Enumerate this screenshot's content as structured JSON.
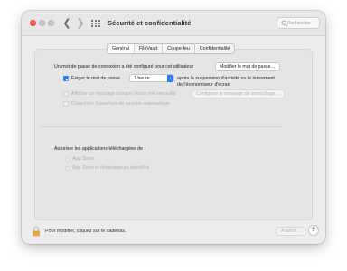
{
  "window": {
    "title": "Sécurité et confidentialité",
    "search_placeholder": "Rechercher"
  },
  "tabs": [
    {
      "label": "Général",
      "active": true
    },
    {
      "label": "FileVault",
      "active": false
    },
    {
      "label": "Coupe-feu",
      "active": false
    },
    {
      "label": "Confidentialité",
      "active": false
    }
  ],
  "general": {
    "password_text": "Un mot de passe de connexion a été configuré pour cet utilisateur",
    "change_password_button": "Modifier le mot de passe…",
    "require_password_label": "Exiger le mot de passe",
    "require_password_checked": true,
    "delay_select_value": "1 heure",
    "after_text_line1": "après la suspension d'activité ou le lancement",
    "after_text_line2": "de l'économiseur d'écran",
    "show_message_label": "Afficher un message lorsque l'écran est verrouillé",
    "configure_message_button": "Configurer le message de verrouillage…",
    "disable_auto_login_label": "Désactiver l'ouverture de session automatique"
  },
  "downloads": {
    "heading": "Autoriser les applications téléchargées de :",
    "options": [
      "App Store",
      "App Store et développeurs identifiés"
    ]
  },
  "footer": {
    "lock_text": "Pour modifier, cliquez sur le cadenas.",
    "advanced_button": "Avancé…",
    "help_button": "?"
  },
  "colors": {
    "accent": "#2a7cf6",
    "close": "#ff5f57",
    "lock": "#e2a94e"
  }
}
